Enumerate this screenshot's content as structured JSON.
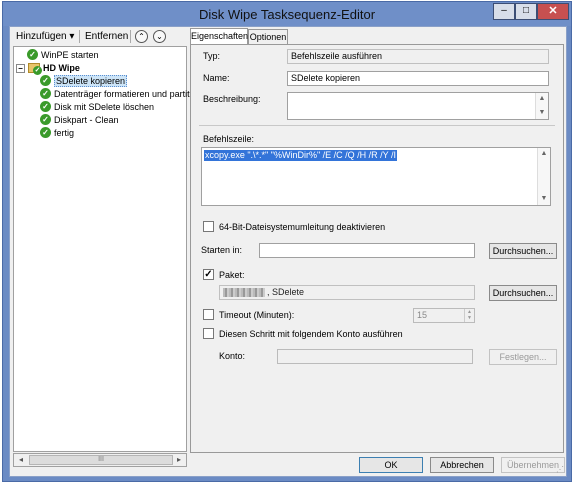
{
  "window": {
    "title": "Disk Wipe Tasksequenz-Editor",
    "minimize": "–",
    "maximize": "□",
    "close": "✕"
  },
  "toolbar": {
    "add_label": "Hinzufügen ▾",
    "remove_label": "Entfernen",
    "move_up": "⌃",
    "move_down": "⌄"
  },
  "tree": {
    "items": [
      {
        "label": "WinPE starten",
        "icon": "check-icon"
      },
      {
        "label": "HD Wipe",
        "icon": "folder-icon",
        "bold": true,
        "expander": "−"
      },
      {
        "label": "SDelete kopieren",
        "icon": "check-icon",
        "selected": true
      },
      {
        "label": "Datenträger formatieren und partit",
        "icon": "check-icon"
      },
      {
        "label": "Disk mit SDelete löschen",
        "icon": "check-icon"
      },
      {
        "label": "Diskpart - Clean",
        "icon": "check-icon"
      },
      {
        "label": "fertig",
        "icon": "check-icon"
      }
    ],
    "scroll_left": "◂",
    "scroll_right": "▸",
    "scroll_thumb": "III"
  },
  "tabs": [
    {
      "label": "Eigenschaften",
      "active": true
    },
    {
      "label": "Optionen",
      "active": false
    }
  ],
  "properties": {
    "type_label": "Typ:",
    "type_value": "Befehlszeile ausführen",
    "name_label": "Name:",
    "name_value": "SDelete kopieren",
    "description_label": "Beschreibung:",
    "description_value": "",
    "commandline_label": "Befehlszeile:",
    "commandline_value": "xcopy.exe \".\\*.*\" \"%WinDir%\" /E /C /Q /H /R /Y /I",
    "redirect_label": "64-Bit-Dateisystemumleitung deaktivieren",
    "redirect_checked": false,
    "startin_label": "Starten in:",
    "startin_value": "",
    "browse_label": "Durchsuchen...",
    "package_label": "Paket:",
    "package_checked": true,
    "package_value": ", SDelete",
    "package_browse_label": "Durchsuchen...",
    "timeout_label": "Timeout (Minuten):",
    "timeout_checked": false,
    "timeout_value": "15",
    "runas_label": "Diesen Schritt mit folgendem Konto ausführen",
    "runas_checked": false,
    "account_label": "Konto:",
    "account_value": "",
    "set_label": "Festlegen..."
  },
  "footer": {
    "ok_label": "OK",
    "cancel_label": "Abbrechen",
    "apply_label": "Übernehmen"
  },
  "colors": {
    "titlebar": "#6f8fc8",
    "selection": "#3374d9",
    "check": "#3a9a2a"
  }
}
